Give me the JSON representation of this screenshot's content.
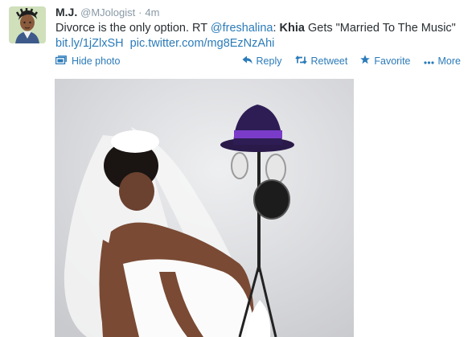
{
  "tweet": {
    "display_name": "M.J.",
    "handle": "@MJologist",
    "separator": "·",
    "time": "4m",
    "text_part1": "Divorce is the only option. RT ",
    "mention": "@freshalina",
    "text_colon": ": ",
    "bold_text": "Khia",
    "text_part2": " Gets \"Married To The Music\"",
    "link1": "bit.ly/1jZlxSH",
    "link2": "pic.twitter.com/mg8EzNzAhi"
  },
  "media": {
    "hide_label": "Hide photo"
  },
  "actions": {
    "reply": "Reply",
    "retweet": "Retweet",
    "favorite": "Favorite",
    "more": "More"
  },
  "icons": {
    "hide_photo": "photo-icon",
    "reply": "reply-arrow-icon",
    "retweet": "retweet-icon",
    "favorite": "star-icon",
    "more": "ellipsis-icon"
  },
  "colors": {
    "link": "#2b7bb9",
    "muted": "#8899a6",
    "text": "#292f33"
  }
}
